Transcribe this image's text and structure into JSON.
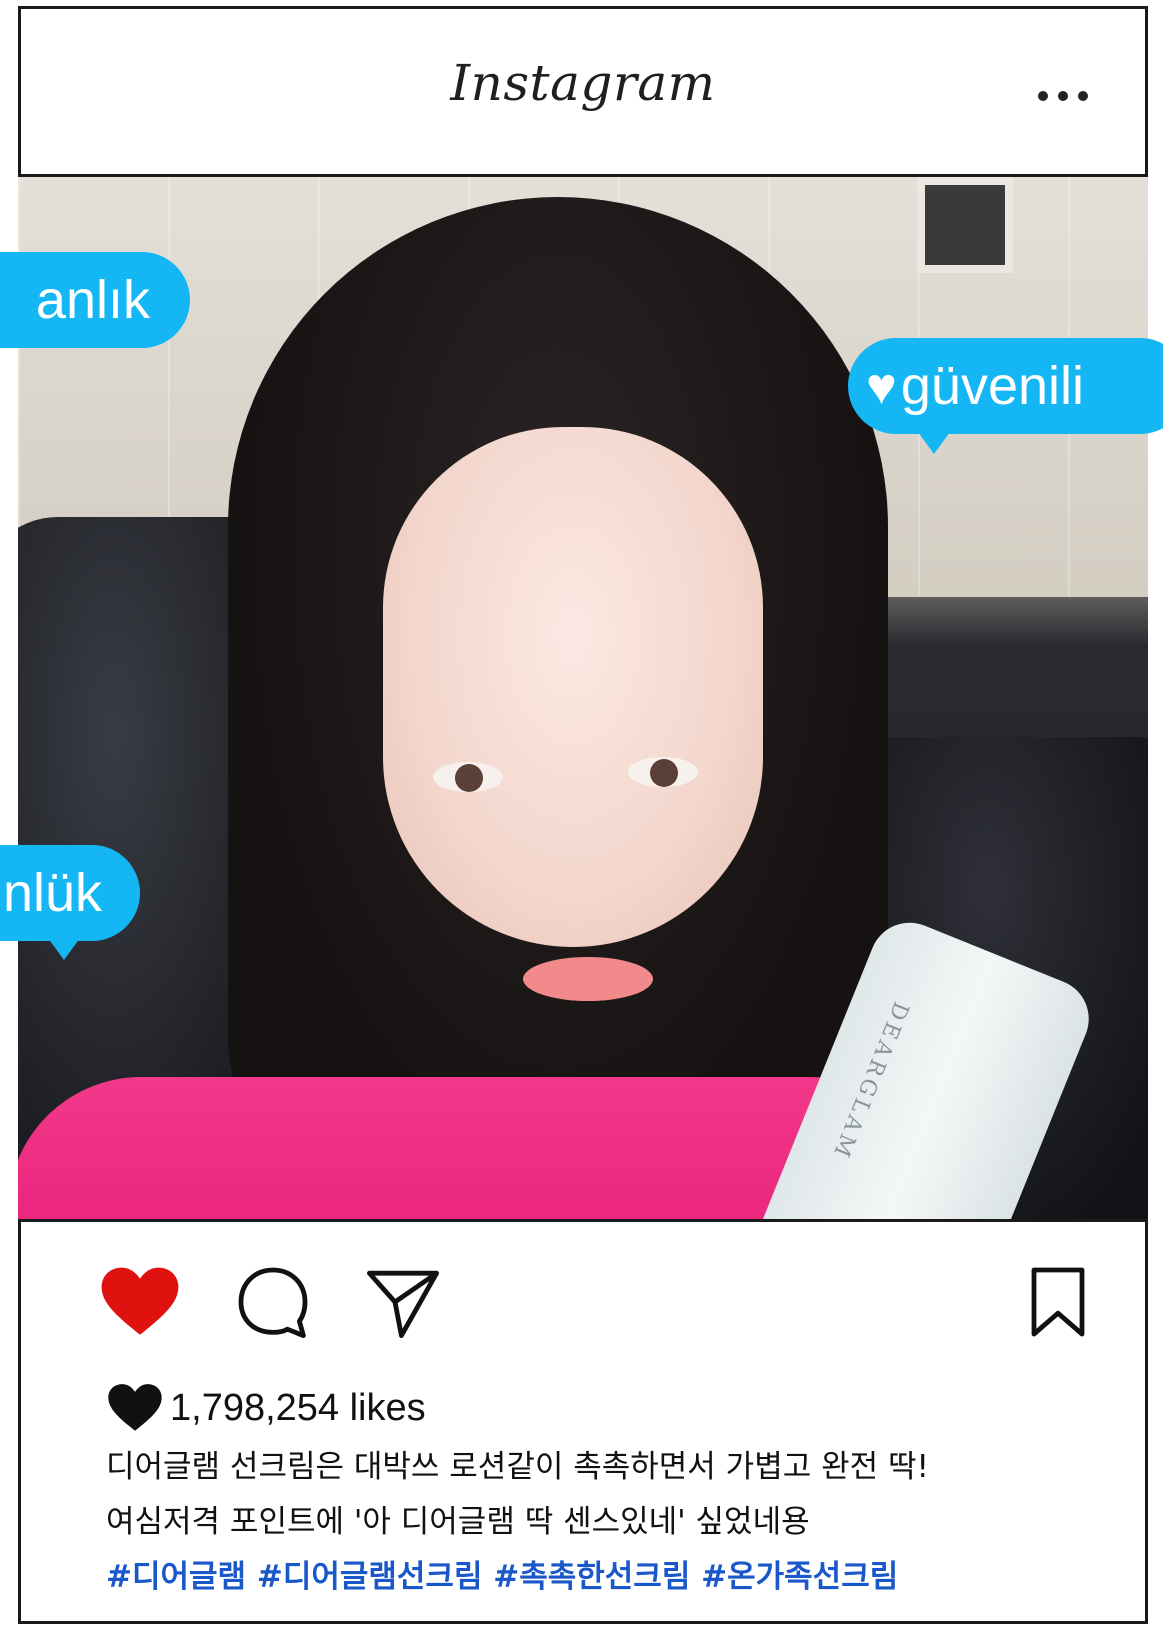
{
  "header": {
    "app_title": "Instagram",
    "more_icon": "more-horizontal-icon"
  },
  "bubbles": [
    {
      "text": "anlık",
      "color": "#14b6f4"
    },
    {
      "heart": "♥",
      "text": "güvenili",
      "color": "#14b6f4"
    },
    {
      "text": "nlük",
      "color": "#14b6f4"
    }
  ],
  "photo": {
    "product_text": "DEARGLAM"
  },
  "actions": {
    "like_icon": "heart-filled-icon",
    "like_color": "#e0120f",
    "comment_icon": "comment-bubble-icon",
    "share_icon": "paper-plane-icon",
    "save_icon": "bookmark-icon"
  },
  "post": {
    "likes": "1,798,254 likes",
    "caption_lines": [
      "디어글램 선크림은 대박쓰 로션같이 촉촉하면서 가볍고 완전 딱!",
      "여심저격 포인트에 '아 디어글램 딱 센스있네' 싶었네용"
    ],
    "hashtags": "#디어글램 #디어글램선크림 #촉촉한선크림 #온가족선크림",
    "hashtag_color": "#1a57c8"
  }
}
